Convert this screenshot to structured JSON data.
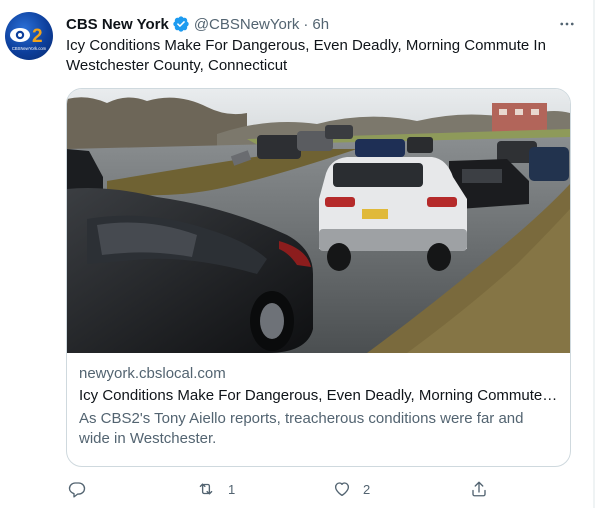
{
  "tweet": {
    "display_name": "CBS New York",
    "handle": "@CBSNewYork",
    "separator": "·",
    "time": "6h",
    "text": "Icy Conditions Make For Dangerous, Even Deadly, Morning Commute In Westchester County, Connecticut",
    "avatar_text": "CBSNewYork.com",
    "avatar_logo_text": "2"
  },
  "card": {
    "domain": "newyork.cbslocal.com",
    "title": "Icy Conditions Make For Dangerous, Even Deadly, Morning Commute I...",
    "description": "As CBS2's Tony Aiello reports, treacherous conditions were far and wide in Westchester."
  },
  "actions": {
    "reply": {
      "icon": "reply-icon",
      "count": ""
    },
    "retweet": {
      "icon": "retweet-icon",
      "count": "1"
    },
    "like": {
      "icon": "heart-icon",
      "count": "2"
    },
    "share": {
      "icon": "share-icon",
      "count": ""
    }
  },
  "colors": {
    "verified": "#1d9bf0",
    "secondary_text": "#536471",
    "primary_text": "#0f1419",
    "border": "#cfd9de"
  }
}
